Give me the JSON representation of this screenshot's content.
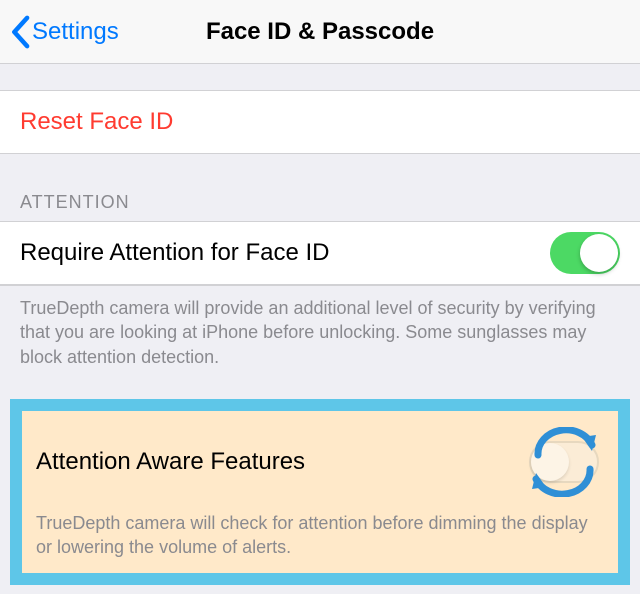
{
  "nav": {
    "back_label": "Settings",
    "title": "Face ID & Passcode"
  },
  "reset": {
    "label": "Reset Face ID"
  },
  "attention": {
    "header": "ATTENTION",
    "require_label": "Require Attention for Face ID",
    "require_on": true,
    "require_footer": "TrueDepth camera will provide an additional level of security by verifying that you are looking at iPhone before unlocking. Some sunglasses may block attention detection."
  },
  "aware": {
    "label": "Attention Aware Features",
    "on": false,
    "footer": "TrueDepth camera will check for attention before dimming the display or lowering the volume of alerts."
  },
  "colors": {
    "accent": "#0079ff",
    "destructive": "#ff3b30",
    "switch_on": "#4cd964",
    "highlight_border": "#5ec6e8",
    "highlight_bg": "#ffe9c9"
  }
}
